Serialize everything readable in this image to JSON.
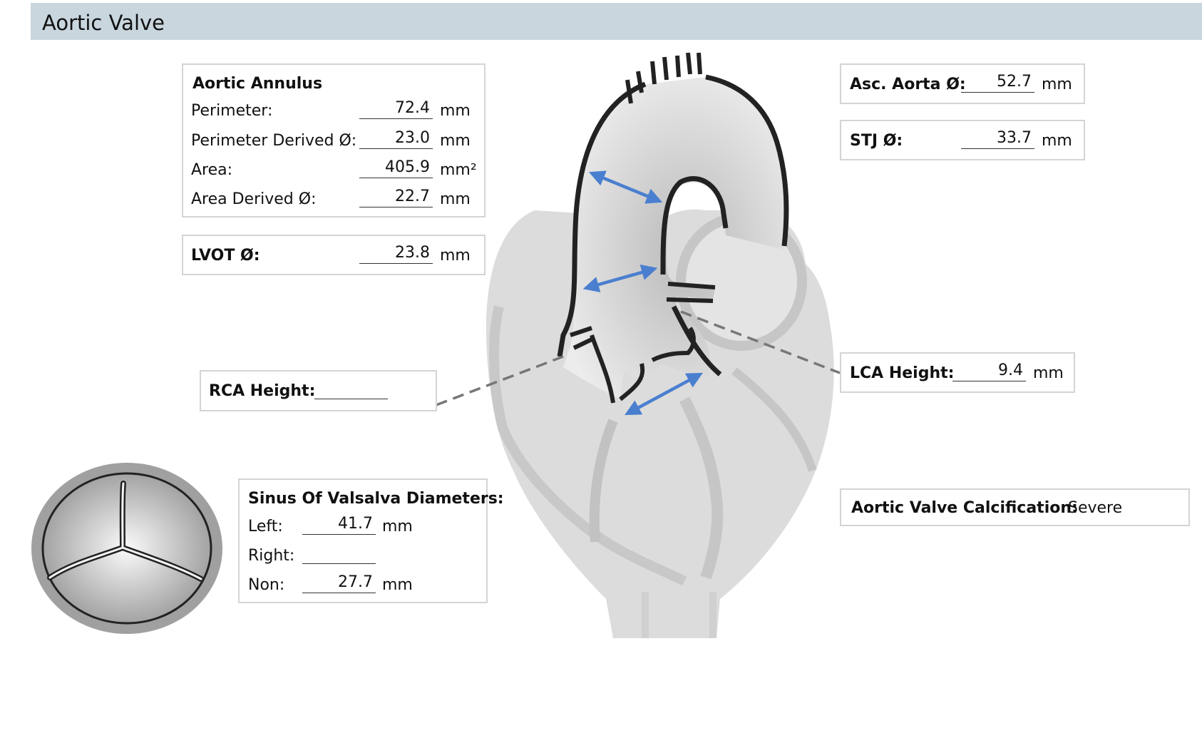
{
  "header": {
    "title": "Aortic Valve"
  },
  "annulus": {
    "title": "Aortic Annulus",
    "rows": [
      {
        "label": "Perimeter:",
        "value": "72.4",
        "unit": "mm"
      },
      {
        "label": "Perimeter Derived Ø:",
        "value": "23.0",
        "unit": "mm"
      },
      {
        "label": "Area:",
        "value": "405.9",
        "unit": "mm²"
      },
      {
        "label": "Area Derived Ø:",
        "value": "22.7",
        "unit": "mm"
      }
    ]
  },
  "lvot": {
    "label": "LVOT Ø:",
    "value": "23.8",
    "unit": "mm"
  },
  "rca": {
    "label": "RCA Height:",
    "value": ""
  },
  "sinus": {
    "title": "Sinus Of Valsalva Diameters:",
    "rows": [
      {
        "label": "Left:",
        "value": "41.7",
        "unit": "mm"
      },
      {
        "label": "Right:",
        "value": "",
        "unit": ""
      },
      {
        "label": "Non:",
        "value": "27.7",
        "unit": "mm"
      }
    ]
  },
  "asc_aorta": {
    "label": "Asc. Aorta Ø:",
    "value": "52.7",
    "unit": "mm"
  },
  "stj": {
    "label": "STJ Ø:",
    "value": "33.7",
    "unit": "mm"
  },
  "lca": {
    "label": "LCA Height:",
    "value": "9.4",
    "unit": "mm"
  },
  "calcification": {
    "label": "Aortic Valve Calcification:",
    "value": "Severe"
  },
  "colors": {
    "header_bg": "#c9d6de",
    "arrow": "#4a7fcf",
    "box_border": "#d4d4d4"
  }
}
